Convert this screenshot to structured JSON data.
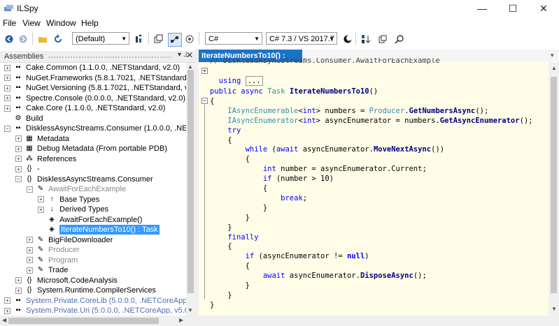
{
  "window": {
    "title": "ILSpy",
    "min": "—",
    "max": "☐",
    "close": "✕"
  },
  "menu": [
    "File",
    "View",
    "Window",
    "Help"
  ],
  "toolbar": {
    "language_profile": "(Default)",
    "language": "C#",
    "language_version": "C# 7.3 / VS 2017.7"
  },
  "assemblies": {
    "title": "Assemblies",
    "pin": "▾ ⊥",
    "close": "✕",
    "rows": [
      {
        "label": "Cake.Common (1.1.0.0, .NETStandard, v2.0)",
        "indent": 0,
        "exp": "+",
        "icon": "▪▪",
        "style": ""
      },
      {
        "label": "NuGet.Frameworks (5.8.1.7021, .NETStandard, v2.0",
        "indent": 0,
        "exp": "+",
        "icon": "▪▪",
        "style": ""
      },
      {
        "label": "NuGet.Versioning (5.8.1.7021, .NETStandard, v2.0)",
        "indent": 0,
        "exp": "+",
        "icon": "▪▪",
        "style": ""
      },
      {
        "label": "Spectre.Console (0.0.0.0, .NETStandard, v2.0)",
        "indent": 0,
        "exp": "+",
        "icon": "▪▪",
        "style": ""
      },
      {
        "label": "Cake.Core (1.1.0.0, .NETStandard, v2.0)",
        "indent": 0,
        "exp": "+",
        "icon": "▪▪",
        "style": ""
      },
      {
        "label": "Build",
        "indent": 0,
        "exp": "",
        "icon": "⚙",
        "style": ""
      },
      {
        "label": "DisklessAsyncStreams.Consumer (1.0.0.0, .NETCore",
        "indent": 0,
        "exp": "−",
        "icon": "▪▪",
        "style": ""
      },
      {
        "label": "Metadata",
        "indent": 1,
        "exp": "+",
        "icon": "▦",
        "style": ""
      },
      {
        "label": "Debug Metadata (From portable PDB)",
        "indent": 1,
        "exp": "+",
        "icon": "▦",
        "style": ""
      },
      {
        "label": "References",
        "indent": 1,
        "exp": "+",
        "icon": "⁂",
        "style": ""
      },
      {
        "label": "-",
        "indent": 1,
        "exp": "+",
        "icon": "{}",
        "style": ""
      },
      {
        "label": "DisklessAsyncStreams.Consumer",
        "indent": 1,
        "exp": "−",
        "icon": "{}",
        "style": ""
      },
      {
        "label": "AwaitForEachExample",
        "indent": 2,
        "exp": "−",
        "icon": "✎",
        "style": "gray"
      },
      {
        "label": "Base Types",
        "indent": 3,
        "exp": "+",
        "icon": "↑",
        "style": ""
      },
      {
        "label": "Derived Types",
        "indent": 3,
        "exp": "+",
        "icon": "↓",
        "style": ""
      },
      {
        "label": "AwaitForEachExample()",
        "indent": 3,
        "exp": "",
        "icon": "◈",
        "style": ""
      },
      {
        "label": "IterateNumbersTo10() : Task",
        "indent": 3,
        "exp": "",
        "icon": "◈",
        "style": "sel"
      },
      {
        "label": "BigFileDownloader",
        "indent": 2,
        "exp": "+",
        "icon": "✎",
        "style": ""
      },
      {
        "label": "Producer",
        "indent": 2,
        "exp": "+",
        "icon": "✎",
        "style": "gray"
      },
      {
        "label": "Program",
        "indent": 2,
        "exp": "+",
        "icon": "✎",
        "style": "gray"
      },
      {
        "label": "Trade",
        "indent": 2,
        "exp": "+",
        "icon": "✎",
        "style": ""
      },
      {
        "label": "Microsoft.CodeAnalysis",
        "indent": 1,
        "exp": "+",
        "icon": "{}",
        "style": ""
      },
      {
        "label": "System.Runtime.CompilerServices",
        "indent": 1,
        "exp": "+",
        "icon": "{}",
        "style": ""
      },
      {
        "label": "System.Private.CoreLib (5.0.0.0, .NETCoreApp, v5.0",
        "indent": 0,
        "exp": "+",
        "icon": "▪▪",
        "style": "blue"
      },
      {
        "label": "System.Private.Uri (5.0.0.0, .NETCoreApp, v5.0)",
        "indent": 0,
        "exp": "+",
        "icon": "▪▪",
        "style": "blue"
      }
    ]
  },
  "editor": {
    "tab_label": "IterateNumbersTo10() : Task",
    "tab_dropdown": "▾",
    "header_comment": "// DisklessAsyncStreams.Consumer.AwaitForEachExample",
    "using_keyword": "using",
    "using_collapsed": "...",
    "code": [
      [
        [
          "kw",
          "public "
        ],
        [
          "kw",
          "async "
        ],
        [
          "ty",
          "Task "
        ],
        [
          "fn",
          "IterateNumbersTo10"
        ],
        [
          "",
          "()"
        ]
      ],
      [
        [
          "",
          "{"
        ]
      ],
      [
        [
          "",
          "    "
        ],
        [
          "ty",
          "IAsyncEnumerable"
        ],
        [
          "",
          "<"
        ],
        [
          "kw",
          "int"
        ],
        [
          "",
          "> numbers = "
        ],
        [
          "ty",
          "Producer"
        ],
        [
          "",
          "."
        ],
        [
          "fn",
          "GetNumbersAsync"
        ],
        [
          "",
          "();"
        ]
      ],
      [
        [
          "",
          "    "
        ],
        [
          "ty",
          "IAsyncEnumerator"
        ],
        [
          "",
          "<"
        ],
        [
          "kw",
          "int"
        ],
        [
          "",
          "> asyncEnumerator = numbers."
        ],
        [
          "fn",
          "GetAsyncEnumerator"
        ],
        [
          "",
          "();"
        ]
      ],
      [
        [
          "",
          "    "
        ],
        [
          "kw",
          "try"
        ]
      ],
      [
        [
          "",
          "    {"
        ]
      ],
      [
        [
          "",
          "        "
        ],
        [
          "kw",
          "while "
        ],
        [
          "",
          "("
        ],
        [
          "kw",
          "await "
        ],
        [
          "",
          "asyncEnumerator."
        ],
        [
          "fn",
          "MoveNextAsync"
        ],
        [
          "",
          "())"
        ]
      ],
      [
        [
          "",
          "        {"
        ]
      ],
      [
        [
          "",
          "            "
        ],
        [
          "kw",
          "int "
        ],
        [
          "",
          "number = asyncEnumerator.Current;"
        ]
      ],
      [
        [
          "",
          "            "
        ],
        [
          "kw",
          "if "
        ],
        [
          "",
          "(number > 10)"
        ]
      ],
      [
        [
          "",
          "            {"
        ]
      ],
      [
        [
          "",
          "                "
        ],
        [
          "kw",
          "break"
        ],
        [
          "",
          ";"
        ]
      ],
      [
        [
          "",
          "            }"
        ]
      ],
      [
        [
          "",
          "        }"
        ]
      ],
      [
        [
          "",
          "    }"
        ]
      ],
      [
        [
          "",
          "    "
        ],
        [
          "kw",
          "finally"
        ]
      ],
      [
        [
          "",
          "    {"
        ]
      ],
      [
        [
          "",
          "        "
        ],
        [
          "kw",
          "if "
        ],
        [
          "",
          "(asyncEnumerator != "
        ],
        [
          "kwb",
          "null"
        ],
        [
          "",
          ")"
        ]
      ],
      [
        [
          "",
          "        {"
        ]
      ],
      [
        [
          "",
          "            "
        ],
        [
          "kw",
          "await "
        ],
        [
          "",
          "asyncEnumerator."
        ],
        [
          "fn",
          "DisposeAsync"
        ],
        [
          "",
          "();"
        ]
      ],
      [
        [
          "",
          "        }"
        ]
      ],
      [
        [
          "",
          "    }"
        ]
      ],
      [
        [
          "",
          "}"
        ]
      ]
    ]
  }
}
